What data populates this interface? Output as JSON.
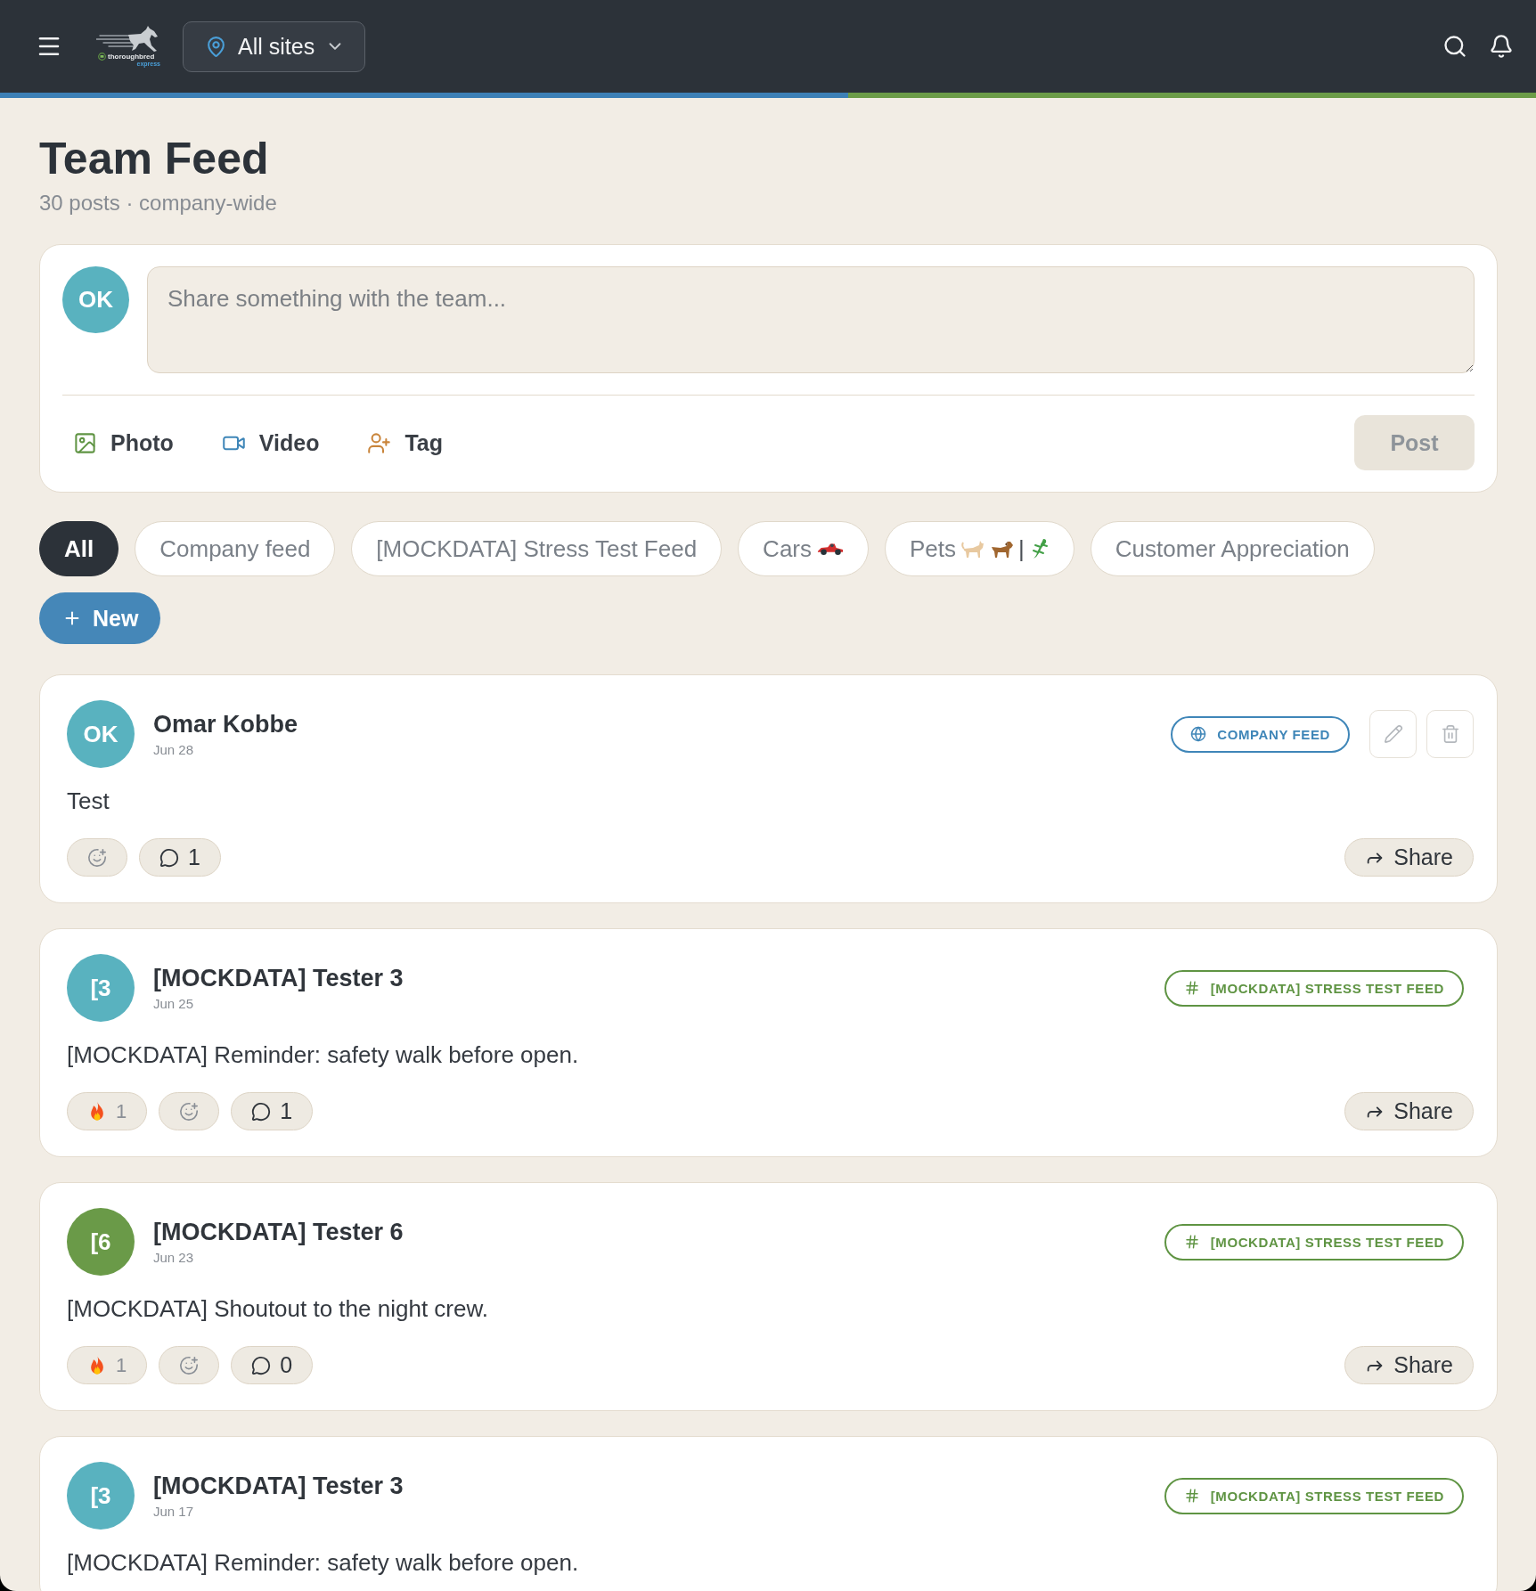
{
  "header": {
    "logo": {
      "line_1": "thoroughbred",
      "line_2": "express"
    },
    "site_selector": {
      "value": "All sites"
    }
  },
  "page": {
    "title": "Team Feed",
    "subtitle": "30 posts · company-wide"
  },
  "composer": {
    "avatar": {
      "initials": "OK"
    },
    "placeholder": "Share something with the team...",
    "attachments": [
      {
        "kind": "photo",
        "label": "Photo"
      },
      {
        "kind": "video",
        "label": "Video"
      },
      {
        "kind": "tag",
        "label": "Tag"
      }
    ],
    "submit": {
      "label": "Post",
      "disabled": true
    }
  },
  "filters": [
    {
      "label": "All",
      "kind": "plain",
      "selected": true
    },
    {
      "label": "Company feed",
      "kind": "plain",
      "selected": false
    },
    {
      "label": "[MOCKDATA] Stress Test Feed",
      "kind": "plain",
      "selected": false
    },
    {
      "label": "Cars",
      "kind": "cars",
      "selected": false
    },
    {
      "label": "Pets",
      "kind": "pets",
      "separator": "|",
      "selected": false
    },
    {
      "label": "Customer Appreciation",
      "kind": "plain",
      "selected": false
    }
  ],
  "new_button": {
    "label": "New"
  },
  "posts": [
    {
      "author": "Omar Kobbe",
      "date": "Jun 28",
      "avatar": {
        "initials": "OK",
        "color": "#59b2bf"
      },
      "badge": {
        "kind": "company",
        "label": "COMPANY FEED"
      },
      "editable": true,
      "body": "Test",
      "reactions": [
        {
          "kind": "add"
        },
        {
          "kind": "comments",
          "count": "1"
        }
      ],
      "share": "Share"
    },
    {
      "author": "[MOCKDATA] Tester 3",
      "date": "Jun 25",
      "avatar": {
        "initials": "[3",
        "color": "#59b2bf"
      },
      "badge": {
        "kind": "channel",
        "label": "[MOCKDATA] STRESS TEST FEED"
      },
      "editable": false,
      "body": "[MOCKDATA] Reminder: safety walk before open.",
      "reactions": [
        {
          "kind": "fire",
          "count": "1"
        },
        {
          "kind": "add"
        },
        {
          "kind": "comments",
          "count": "1"
        }
      ],
      "share": "Share"
    },
    {
      "author": "[MOCKDATA] Tester 6",
      "date": "Jun 23",
      "avatar": {
        "initials": "[6",
        "color": "#6a9a48"
      },
      "badge": {
        "kind": "channel",
        "label": "[MOCKDATA] STRESS TEST FEED"
      },
      "editable": false,
      "body": "[MOCKDATA] Shoutout to the night crew.",
      "reactions": [
        {
          "kind": "fire",
          "count": "1"
        },
        {
          "kind": "add"
        },
        {
          "kind": "comments",
          "count": "0"
        }
      ],
      "share": "Share"
    },
    {
      "author": "[MOCKDATA] Tester 3",
      "date": "Jun 17",
      "avatar": {
        "initials": "[3",
        "color": "#59b2bf"
      },
      "badge": {
        "kind": "channel",
        "label": "[MOCKDATA] STRESS TEST FEED"
      },
      "editable": false,
      "body": "[MOCKDATA] Reminder: safety walk before open."
    }
  ]
}
